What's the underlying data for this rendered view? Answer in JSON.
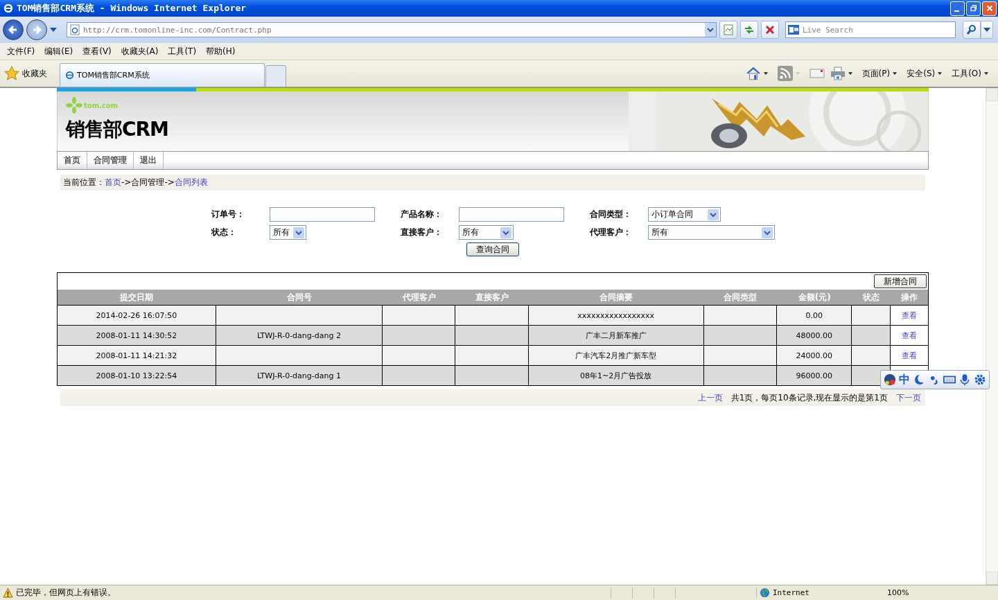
{
  "window": {
    "title": "TOM销售部CRM系统 - Windows Internet Explorer"
  },
  "address_bar": {
    "url": "http://crm.tomonline-inc.com/Contract.php",
    "search_placeholder": "Live Search"
  },
  "menu": [
    "文件(F)",
    "编辑(E)",
    "查看(V)",
    "收藏夹(A)",
    "工具(T)",
    "帮助(H)"
  ],
  "favorites": {
    "label": "收藏夹"
  },
  "tabs": [
    {
      "label": "TOM销售部CRM系统",
      "selected": true
    }
  ],
  "command_bar": [
    "页面(P)",
    "安全(S)",
    "工具(O)"
  ],
  "page": {
    "logo": "tom.com",
    "title": "销售部CRM",
    "nav": [
      "首页",
      "合同管理",
      "退出"
    ],
    "breadcrumb": {
      "label": "当前位置：",
      "parts": [
        {
          "text": "首页",
          "link": true
        },
        {
          "text": "->合同管理->",
          "link": false
        },
        {
          "text": "合同列表",
          "link": true
        }
      ]
    },
    "form": {
      "fields": [
        {
          "label": "订单号：",
          "kind": "input"
        },
        {
          "label": "产品名称：",
          "kind": "input"
        },
        {
          "label": "合同类型：",
          "kind": "select",
          "value": "小订单合同"
        },
        {
          "label": "状态：",
          "kind": "select",
          "value": "所有"
        },
        {
          "label": "直接客户：",
          "kind": "select",
          "value": "所有"
        },
        {
          "label": "代理客户：",
          "kind": "select",
          "value": "所有"
        }
      ],
      "submit": "查询合同"
    },
    "add_button": "新增合同",
    "table": {
      "columns": [
        "提交日期",
        "合同号",
        "代理客户",
        "直接客户",
        "合同摘要",
        "合同类型",
        "金额(元)",
        "状态",
        "操作"
      ],
      "rows": [
        {
          "cells": [
            "2014-02-26 16:07:50",
            "",
            "",
            "",
            "xxxxxxxxxxxxxxxxx",
            "",
            "0.00",
            ""
          ],
          "action": "查看"
        },
        {
          "cells": [
            "2008-01-11 14:30:52",
            "LTWJ-R-0-dang-dang 2",
            "",
            "",
            "广丰二月新车推广",
            "",
            "48000.00",
            ""
          ],
          "action": "查看"
        },
        {
          "cells": [
            "2008-01-11 14:21:32",
            "",
            "",
            "",
            "广丰汽车2月推广新车型",
            "",
            "24000.00",
            ""
          ],
          "action": "查看"
        },
        {
          "cells": [
            "2008-01-10 13:22:54",
            "LTWJ-R-0-dang-dang 1",
            "",
            "",
            "08年1~2月广告投放",
            "",
            "96000.00",
            ""
          ]
        }
      ]
    },
    "pager": {
      "prev": "上一页",
      "info": "共1页，每页10条记录,现在显示的是第1页",
      "next": "下一页"
    }
  },
  "ime_bar": {
    "mode": "中"
  },
  "status_bar": {
    "text": "已完毕，但网页上有错误。",
    "zone": "Internet",
    "zoom": "100%"
  }
}
